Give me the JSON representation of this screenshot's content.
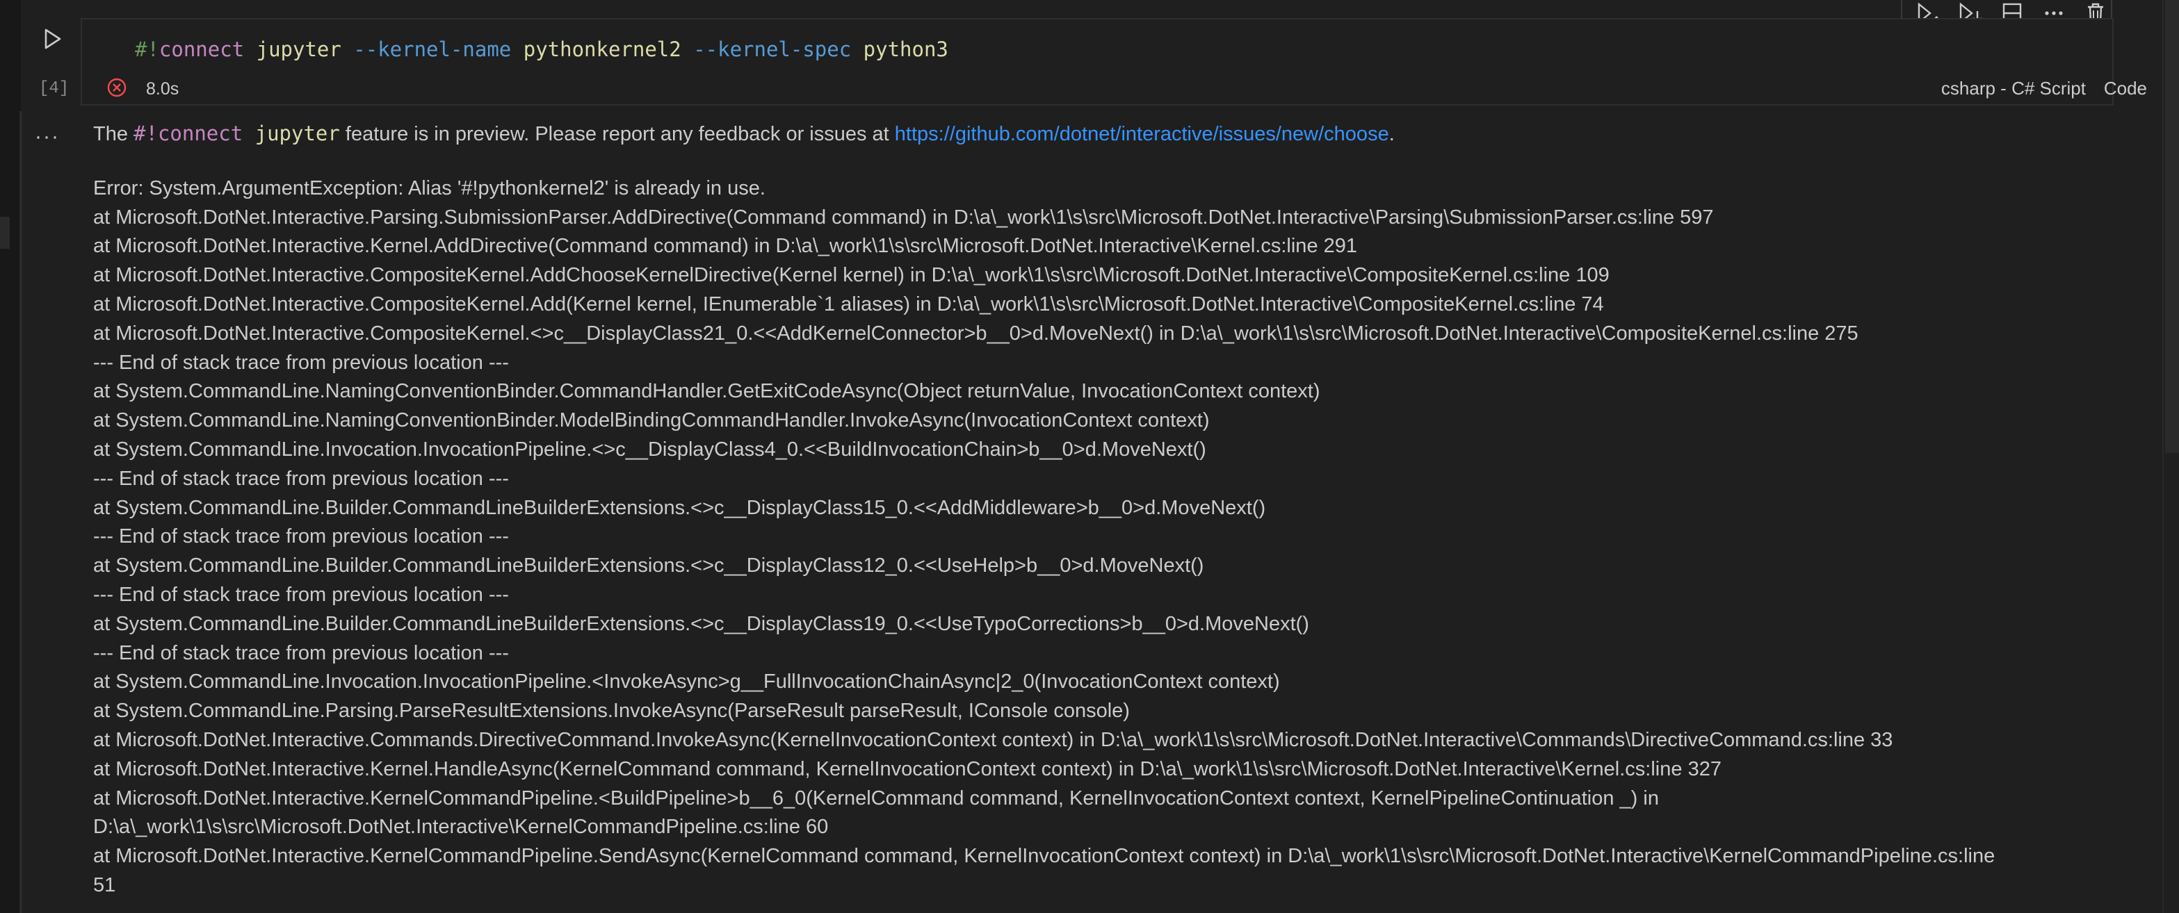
{
  "cell": {
    "code": {
      "hash": "#!",
      "keyword": "connect",
      "target": "jupyter",
      "opt1": "--kernel-name",
      "val1": "pythonkernel2",
      "opt2": "--kernel-spec",
      "val2": "python3"
    },
    "execution_count": "[4]",
    "exec_time": "8.0s",
    "language": "csharp - C# Script",
    "kind": "Code",
    "status": "error"
  },
  "toolbar": {
    "items": [
      "run-by-line-icon",
      "execute-below-icon",
      "split-cell-icon",
      "more-actions-icon",
      "delete-cell-icon"
    ]
  },
  "output": {
    "more_label": "···",
    "preview": {
      "prefix": "The ",
      "code": "#!connect jupyter",
      "middle": " feature is in preview. Please report any feedback or issues at ",
      "link": "https://github.com/dotnet/interactive/issues/new/choose",
      "suffix": "."
    },
    "lines": [
      "Error: System.ArgumentException: Alias '#!pythonkernel2' is already in use.",
      "at Microsoft.DotNet.Interactive.Parsing.SubmissionParser.AddDirective(Command command) in D:\\a\\_work\\1\\s\\src\\Microsoft.DotNet.Interactive\\Parsing\\SubmissionParser.cs:line 597",
      "at Microsoft.DotNet.Interactive.Kernel.AddDirective(Command command) in D:\\a\\_work\\1\\s\\src\\Microsoft.DotNet.Interactive\\Kernel.cs:line 291",
      "at Microsoft.DotNet.Interactive.CompositeKernel.AddChooseKernelDirective(Kernel kernel) in D:\\a\\_work\\1\\s\\src\\Microsoft.DotNet.Interactive\\CompositeKernel.cs:line 109",
      "at Microsoft.DotNet.Interactive.CompositeKernel.Add(Kernel kernel, IEnumerable`1 aliases) in D:\\a\\_work\\1\\s\\src\\Microsoft.DotNet.Interactive\\CompositeKernel.cs:line 74",
      "at Microsoft.DotNet.Interactive.CompositeKernel.<>c__DisplayClass21_0.<<AddKernelConnector>b__0>d.MoveNext() in D:\\a\\_work\\1\\s\\src\\Microsoft.DotNet.Interactive\\CompositeKernel.cs:line 275",
      "--- End of stack trace from previous location ---",
      "at System.CommandLine.NamingConventionBinder.CommandHandler.GetExitCodeAsync(Object returnValue, InvocationContext context)",
      "at System.CommandLine.NamingConventionBinder.ModelBindingCommandHandler.InvokeAsync(InvocationContext context)",
      "at System.CommandLine.Invocation.InvocationPipeline.<>c__DisplayClass4_0.<<BuildInvocationChain>b__0>d.MoveNext()",
      "--- End of stack trace from previous location ---",
      "at System.CommandLine.Builder.CommandLineBuilderExtensions.<>c__DisplayClass15_0.<<AddMiddleware>b__0>d.MoveNext()",
      "--- End of stack trace from previous location ---",
      "at System.CommandLine.Builder.CommandLineBuilderExtensions.<>c__DisplayClass12_0.<<UseHelp>b__0>d.MoveNext()",
      "--- End of stack trace from previous location ---",
      "at System.CommandLine.Builder.CommandLineBuilderExtensions.<>c__DisplayClass19_0.<<UseTypoCorrections>b__0>d.MoveNext()",
      "--- End of stack trace from previous location ---",
      "at System.CommandLine.Invocation.InvocationPipeline.<InvokeAsync>g__FullInvocationChainAsync|2_0(InvocationContext context)",
      "at System.CommandLine.Parsing.ParseResultExtensions.InvokeAsync(ParseResult parseResult, IConsole console)",
      "at Microsoft.DotNet.Interactive.Commands.DirectiveCommand.InvokeAsync(KernelInvocationContext context) in D:\\a\\_work\\1\\s\\src\\Microsoft.DotNet.Interactive\\Commands\\DirectiveCommand.cs:line 33",
      "at Microsoft.DotNet.Interactive.Kernel.HandleAsync(KernelCommand command, KernelInvocationContext context) in D:\\a\\_work\\1\\s\\src\\Microsoft.DotNet.Interactive\\Kernel.cs:line 327",
      "at Microsoft.DotNet.Interactive.KernelCommandPipeline.<BuildPipeline>b__6_0(KernelCommand command, KernelInvocationContext context, KernelPipelineContinuation _) in",
      "D:\\a\\_work\\1\\s\\src\\Microsoft.DotNet.Interactive\\KernelCommandPipeline.cs:line 60",
      "at Microsoft.DotNet.Interactive.KernelCommandPipeline.SendAsync(KernelCommand command, KernelInvocationContext context) in D:\\a\\_work\\1\\s\\src\\Microsoft.DotNet.Interactive\\KernelCommandPipeline.cs:line",
      "51"
    ]
  },
  "colors": {
    "background": "#1f1f1f",
    "text": "#cccccc",
    "link": "#3794ff",
    "error": "#f14c4c",
    "preprocessor": "#c586c0",
    "option": "#569cd6",
    "value": "#dcdcaa",
    "comment": "#6a9955"
  }
}
